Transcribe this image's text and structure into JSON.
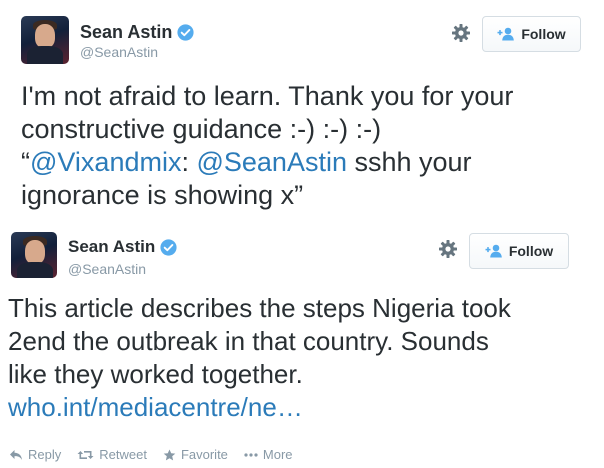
{
  "tweets": [
    {
      "author": {
        "name": "Sean Astin",
        "handle": "@SeanAstin",
        "verified": true
      },
      "follow_label": "Follow",
      "text": {
        "line1": "I'm not afraid to learn. Thank you for your",
        "line2": "constructive guidance :-) :-) :-)",
        "line3_open": "“",
        "mention1": "@Vixandmix",
        "colon": ": ",
        "mention2": "@SeanAstin",
        "line3_rest": " sshh your",
        "line4": "ignorance is showing x”"
      }
    },
    {
      "author": {
        "name": "Sean Astin",
        "handle": "@SeanAstin",
        "verified": true
      },
      "follow_label": "Follow",
      "text": {
        "line1": "This article describes the steps Nigeria took",
        "line2": "2end the outbreak in that country.  Sounds",
        "line3": "like they worked together.",
        "link": "who.int/mediacentre/ne…"
      },
      "actions": {
        "reply": "Reply",
        "retweet": "Retweet",
        "favorite": "Favorite",
        "more": "More"
      }
    }
  ],
  "colors": {
    "link": "#2b7bb9",
    "verified": "#55acee",
    "muted": "#8899a6",
    "text": "#292f33"
  }
}
